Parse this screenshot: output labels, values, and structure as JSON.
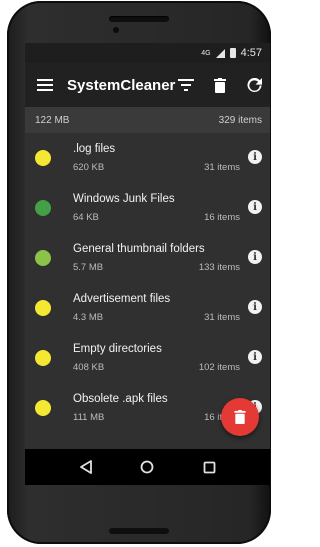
{
  "statusbar": {
    "network": "4G",
    "time": "4:57"
  },
  "toolbar": {
    "title": "SystemCleaner",
    "icons": [
      "menu-icon",
      "filter-icon",
      "trash-icon",
      "refresh-icon"
    ]
  },
  "summary": {
    "total_size": "122 MB",
    "total_items": "329 items"
  },
  "items": [
    {
      "title": ".log files",
      "size": "620 KB",
      "count": "31 items",
      "color": "#f5e833"
    },
    {
      "title": "Windows Junk Files",
      "size": "64 KB",
      "count": "16 items",
      "color": "#43a047"
    },
    {
      "title": "General thumbnail folders",
      "size": "5.7 MB",
      "count": "133 items",
      "color": "#8bc34a"
    },
    {
      "title": "Advertisement files",
      "size": "4.3 MB",
      "count": "31 items",
      "color": "#f5e833"
    },
    {
      "title": "Empty directories",
      "size": "408 KB",
      "count": "102 items",
      "color": "#f5e833"
    },
    {
      "title": "Obsolete .apk files",
      "size": "111 MB",
      "count": "16 items",
      "color": "#f5e833"
    }
  ],
  "info_glyph": "i",
  "colors": {
    "fab": "#e53935",
    "toolbar": "#212121",
    "background": "#303030"
  }
}
